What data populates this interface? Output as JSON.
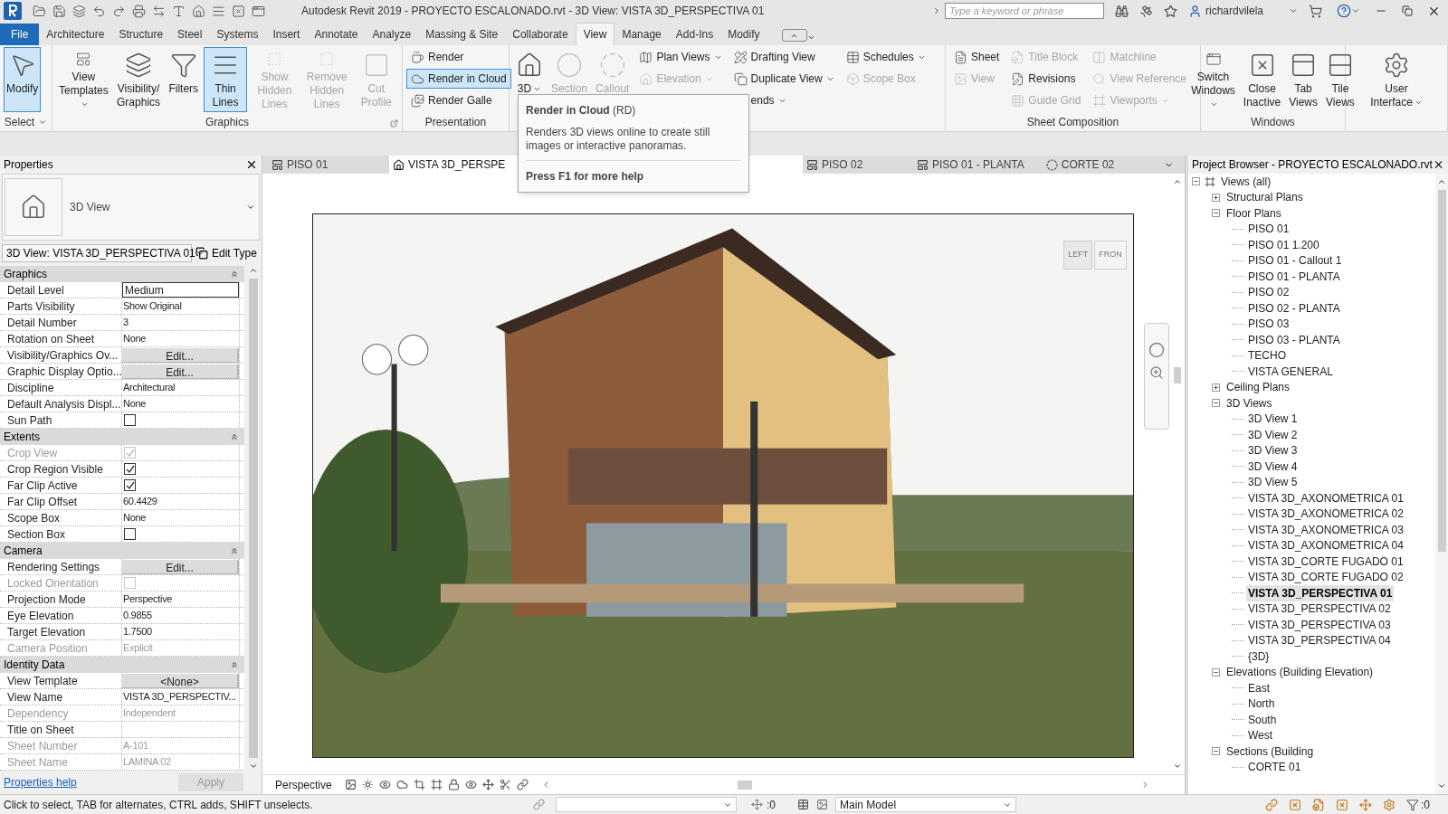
{
  "window": {
    "title": "Autodesk Revit 2019 - PROYECTO ESCALONADO.rvt - 3D View: VISTA 3D_PERSPECTIVA 01",
    "search_placeholder": "Type a keyword or phrase",
    "user": "richardvilela"
  },
  "menu_tabs": [
    {
      "label": "File",
      "kind": "file",
      "selected": false
    },
    {
      "label": "Architecture",
      "kind": "tab",
      "selected": false
    },
    {
      "label": "Structure",
      "kind": "tab",
      "selected": false
    },
    {
      "label": "Steel",
      "kind": "tab",
      "selected": false
    },
    {
      "label": "Systems",
      "kind": "tab",
      "selected": false
    },
    {
      "label": "Insert",
      "kind": "tab",
      "selected": false
    },
    {
      "label": "Annotate",
      "kind": "tab",
      "selected": false
    },
    {
      "label": "Analyze",
      "kind": "tab",
      "selected": false
    },
    {
      "label": "Massing & Site",
      "kind": "tab",
      "selected": false
    },
    {
      "label": "Collaborate",
      "kind": "tab",
      "selected": false
    },
    {
      "label": "View",
      "kind": "tab",
      "selected": true
    },
    {
      "label": "Manage",
      "kind": "tab",
      "selected": false
    },
    {
      "label": "Add-Ins",
      "kind": "tab",
      "selected": false
    },
    {
      "label": "Modify",
      "kind": "tab",
      "selected": false
    }
  ],
  "ribbon_panels": [
    {
      "label": "Select",
      "menu": true,
      "columns": [
        [
          {
            "kind": "large",
            "label": "Modify",
            "selected": true,
            "disabled": false,
            "menu": false
          }
        ]
      ]
    },
    {
      "label": "Graphics",
      "menu": false,
      "columns": [
        [
          {
            "kind": "large",
            "label": "View Templates",
            "selected": false,
            "disabled": false,
            "menu": true
          }
        ],
        [
          {
            "kind": "large",
            "label": "Visibility/ Graphics",
            "selected": false,
            "disabled": false,
            "menu": false
          }
        ],
        [
          {
            "kind": "large",
            "label": "Filters",
            "selected": false,
            "disabled": false,
            "menu": false
          }
        ],
        [
          {
            "kind": "large",
            "label": "Thin Lines",
            "selected": true,
            "disabled": false,
            "menu": false
          }
        ],
        [
          {
            "kind": "large",
            "label": "Show Hidden Lines",
            "selected": false,
            "disabled": true,
            "menu": false
          }
        ],
        [
          {
            "kind": "large",
            "label": "Remove Hidden Lines",
            "selected": false,
            "disabled": true,
            "menu": false
          }
        ],
        [
          {
            "kind": "large",
            "label": "Cut Profile",
            "selected": false,
            "disabled": true,
            "menu": false
          }
        ]
      ]
    },
    {
      "label": "Presentation",
      "menu": false,
      "columns": [
        [
          {
            "kind": "small",
            "label": "Render",
            "selected": false,
            "disabled": false,
            "menu": false
          },
          {
            "kind": "small",
            "label": "Render in Cloud",
            "selected": true,
            "disabled": false,
            "menu": false
          },
          {
            "kind": "small",
            "label": "Render Galle",
            "selected": false,
            "disabled": false,
            "menu": false
          }
        ]
      ]
    },
    {
      "menu": false,
      "columns": [
        [
          {
            "kind": "large",
            "label": "3D",
            "selected": false,
            "disabled": false,
            "menu": true
          }
        ],
        [
          {
            "kind": "large",
            "label": "Section",
            "selected": false,
            "disabled": true,
            "menu": false
          }
        ],
        [
          {
            "kind": "large",
            "label": "Callout",
            "selected": false,
            "disabled": true,
            "menu": false
          }
        ],
        [
          {
            "kind": "small",
            "label": "Plan Views",
            "selected": false,
            "disabled": false,
            "menu": true
          },
          {
            "kind": "small",
            "label": "Elevation",
            "selected": false,
            "disabled": true,
            "menu": true
          }
        ],
        [
          {
            "kind": "small",
            "label": "Drafting View",
            "selected": false,
            "disabled": false,
            "menu": false
          },
          {
            "kind": "small",
            "label": "Duplicate View",
            "selected": false,
            "disabled": false,
            "menu": true
          },
          {
            "kind": "small",
            "label": "ends",
            "selected": false,
            "disabled": false,
            "menu": true
          }
        ],
        [
          {
            "kind": "small",
            "label": "Schedules",
            "selected": false,
            "disabled": false,
            "menu": true
          },
          {
            "kind": "small",
            "label": "Scope Box",
            "selected": false,
            "disabled": true,
            "menu": false
          }
        ]
      ]
    },
    {
      "label": "Sheet Composition",
      "menu": false,
      "columns": [
        [
          {
            "kind": "small",
            "label": "Sheet",
            "selected": false,
            "disabled": false,
            "menu": false
          },
          {
            "kind": "small",
            "label": "View",
            "selected": false,
            "disabled": true,
            "menu": false
          }
        ],
        [
          {
            "kind": "small",
            "label": "Title Block",
            "selected": false,
            "disabled": true,
            "menu": false
          },
          {
            "kind": "small",
            "label": "Revisions",
            "selected": false,
            "disabled": false,
            "menu": false
          },
          {
            "kind": "small",
            "label": "Guide Grid",
            "selected": false,
            "disabled": true,
            "menu": false
          }
        ],
        [
          {
            "kind": "small",
            "label": "Matchline",
            "selected": false,
            "disabled": true,
            "menu": false
          },
          {
            "kind": "small",
            "label": "View Reference",
            "selected": false,
            "disabled": true,
            "menu": false
          },
          {
            "kind": "small",
            "label": "Viewports",
            "selected": false,
            "disabled": true,
            "menu": true
          }
        ]
      ]
    },
    {
      "label": "Windows",
      "menu": false,
      "columns": [
        [
          {
            "kind": "large",
            "label": "Switch Windows",
            "selected": false,
            "disabled": false,
            "menu": true
          }
        ],
        [
          {
            "kind": "large",
            "label": "Close Inactive",
            "selected": false,
            "disabled": false,
            "menu": false
          }
        ],
        [
          {
            "kind": "large",
            "label": "Tab Views",
            "selected": false,
            "disabled": false,
            "menu": false
          }
        ],
        [
          {
            "kind": "large",
            "label": "Tile Views",
            "selected": false,
            "disabled": false,
            "menu": false
          }
        ]
      ]
    },
    {
      "menu": false,
      "columns": [
        [
          {
            "kind": "large",
            "label": "User Interface",
            "selected": false,
            "disabled": false,
            "menu": true
          }
        ]
      ]
    }
  ],
  "tooltip": {
    "title": "Render in Cloud",
    "shortcut": "(RD)",
    "description": "Renders 3D views online to create still images or interactive panoramas.",
    "help": "Press F1 for more help"
  },
  "properties": {
    "title": "Properties",
    "type": "3D View",
    "instance": "3D View: VISTA 3D_PERSPECTIVA 01",
    "edit_type": "Edit Type",
    "help_link": "Properties help",
    "apply": "Apply",
    "groups": [
      {
        "label": "Graphics",
        "rows": [
          {
            "label": "Detail Level",
            "kind": "input",
            "value": "Medium",
            "disabled": false
          },
          {
            "label": "Parts Visibility",
            "kind": "text",
            "value": "Show Original",
            "disabled": false
          },
          {
            "label": "Detail Number",
            "kind": "text",
            "value": "3",
            "disabled": false
          },
          {
            "label": "Rotation on Sheet",
            "kind": "text",
            "value": "None",
            "disabled": false
          },
          {
            "label": "Visibility/Graphics Ov...",
            "kind": "button",
            "value": "Edit...",
            "disabled": false
          },
          {
            "label": "Graphic Display Optio...",
            "kind": "button",
            "value": "Edit...",
            "disabled": false
          },
          {
            "label": "Discipline",
            "kind": "text",
            "value": "Architectural",
            "disabled": false
          },
          {
            "label": "Default Analysis Displ...",
            "kind": "text",
            "value": "None",
            "disabled": false
          },
          {
            "label": "Sun Path",
            "kind": "checkbox",
            "checked": false,
            "disabled": false
          }
        ]
      },
      {
        "label": "Extents",
        "rows": [
          {
            "label": "Crop View",
            "kind": "checkbox",
            "checked": true,
            "disabled": true
          },
          {
            "label": "Crop Region Visible",
            "kind": "checkbox",
            "checked": true,
            "disabled": false
          },
          {
            "label": "Far Clip Active",
            "kind": "checkbox",
            "checked": true,
            "disabled": false
          },
          {
            "label": "Far Clip Offset",
            "kind": "text",
            "value": "60.4429",
            "disabled": false
          },
          {
            "label": "Scope Box",
            "kind": "text",
            "value": "None",
            "disabled": false
          },
          {
            "label": "Section Box",
            "kind": "checkbox",
            "checked": false,
            "disabled": false
          }
        ]
      },
      {
        "label": "Camera",
        "rows": [
          {
            "label": "Rendering Settings",
            "kind": "button",
            "value": "Edit...",
            "disabled": false
          },
          {
            "label": "Locked Orientation",
            "kind": "checkbox",
            "checked": false,
            "disabled": true
          },
          {
            "label": "Projection Mode",
            "kind": "text",
            "value": "Perspective",
            "disabled": false
          },
          {
            "label": "Eye Elevation",
            "kind": "text",
            "value": "0.9855",
            "disabled": false
          },
          {
            "label": "Target Elevation",
            "kind": "text",
            "value": "1.7500",
            "disabled": false
          },
          {
            "label": "Camera Position",
            "kind": "text",
            "value": "Explicit",
            "disabled": true
          }
        ]
      },
      {
        "label": "Identity Data",
        "rows": [
          {
            "label": "View Template",
            "kind": "button",
            "value": "<None>",
            "disabled": false
          },
          {
            "label": "View Name",
            "kind": "text",
            "value": "VISTA 3D_PERSPECTIV...",
            "disabled": false
          },
          {
            "label": "Dependency",
            "kind": "text",
            "value": "Independent",
            "disabled": true
          },
          {
            "label": "Title on Sheet",
            "kind": "text",
            "disabled": false
          },
          {
            "label": "Sheet Number",
            "kind": "text",
            "value": "A-101",
            "disabled": true
          },
          {
            "label": "Sheet Name",
            "kind": "text",
            "value": "LAMINA 02",
            "disabled": true
          }
        ]
      }
    ]
  },
  "view_tabs": [
    {
      "label": "PISO 01",
      "kind": "plan",
      "selected": false
    },
    {
      "label": "VISTA 3D_PERSPE",
      "kind": "perspective",
      "selected": true
    },
    {
      "label": "PISO 02",
      "kind": "plan",
      "selected": false
    },
    {
      "label": "PISO 01 - PLANTA",
      "kind": "plan",
      "selected": false
    },
    {
      "label": "CORTE 02",
      "kind": "section",
      "selected": false
    }
  ],
  "viewcube": {
    "left": "LEFT",
    "front": "FRON"
  },
  "view_control_bar": {
    "mode": "Perspective"
  },
  "project_browser": {
    "title": "Project Browser - PROYECTO ESCALONADO.rvt",
    "tree": [
      {
        "label": "Views (all)",
        "selected": false,
        "expanded": true,
        "children": [
          {
            "label": "Structural Plans",
            "selected": false,
            "expanded": false
          },
          {
            "label": "Floor Plans",
            "selected": false,
            "expanded": true,
            "children": [
              {
                "label": "PISO 01",
                "selected": false
              },
              {
                "label": "PISO 01 1.200",
                "selected": false
              },
              {
                "label": "PISO 01 - Callout 1",
                "selected": false
              },
              {
                "label": "PISO 01 - PLANTA",
                "selected": false
              },
              {
                "label": "PISO 02",
                "selected": false
              },
              {
                "label": "PISO 02 - PLANTA",
                "selected": false
              },
              {
                "label": "PISO 03",
                "selected": false
              },
              {
                "label": "PISO 03 - PLANTA",
                "selected": false
              },
              {
                "label": "TECHO",
                "selected": false
              },
              {
                "label": "VISTA GENERAL",
                "selected": false
              }
            ]
          },
          {
            "label": "Ceiling Plans",
            "selected": false,
            "expanded": false
          },
          {
            "label": "3D Views",
            "selected": false,
            "expanded": true,
            "children": [
              {
                "label": "3D View 1",
                "selected": false
              },
              {
                "label": "3D View 2",
                "selected": false
              },
              {
                "label": "3D View 3",
                "selected": false
              },
              {
                "label": "3D View 4",
                "selected": false
              },
              {
                "label": "3D View 5",
                "selected": false
              },
              {
                "label": "VISTA 3D_AXONOMETRICA 01",
                "selected": false
              },
              {
                "label": "VISTA 3D_AXONOMETRICA 02",
                "selected": false
              },
              {
                "label": "VISTA 3D_AXONOMETRICA 03",
                "selected": false
              },
              {
                "label": "VISTA 3D_AXONOMETRICA 04",
                "selected": false
              },
              {
                "label": "VISTA 3D_CORTE FUGADO 01",
                "selected": false
              },
              {
                "label": "VISTA 3D_CORTE FUGADO 02",
                "selected": false
              },
              {
                "label": "VISTA 3D_PERSPECTIVA 01",
                "selected": true
              },
              {
                "label": "VISTA 3D_PERSPECTIVA 02",
                "selected": false
              },
              {
                "label": "VISTA 3D_PERSPECTIVA 03",
                "selected": false
              },
              {
                "label": "VISTA 3D_PERSPECTIVA 04",
                "selected": false
              },
              {
                "label": "{3D}",
                "selected": false
              }
            ]
          },
          {
            "label": "Elevations (Building Elevation)",
            "selected": false,
            "expanded": true,
            "children": [
              {
                "label": "East",
                "selected": false
              },
              {
                "label": "North",
                "selected": false
              },
              {
                "label": "South",
                "selected": false
              },
              {
                "label": "West",
                "selected": false
              }
            ]
          },
          {
            "label": "Sections (Building",
            "selected": false,
            "expanded": true,
            "children": [
              {
                "label": "CORTE 01",
                "selected": false
              }
            ]
          }
        ]
      }
    ]
  },
  "status_bar": {
    "message": "Click to select, TAB for alternates, CTRL adds, SHIFT unselects.",
    "selection_count": ":0",
    "model": "Main Model",
    "filter_count": ":0"
  }
}
